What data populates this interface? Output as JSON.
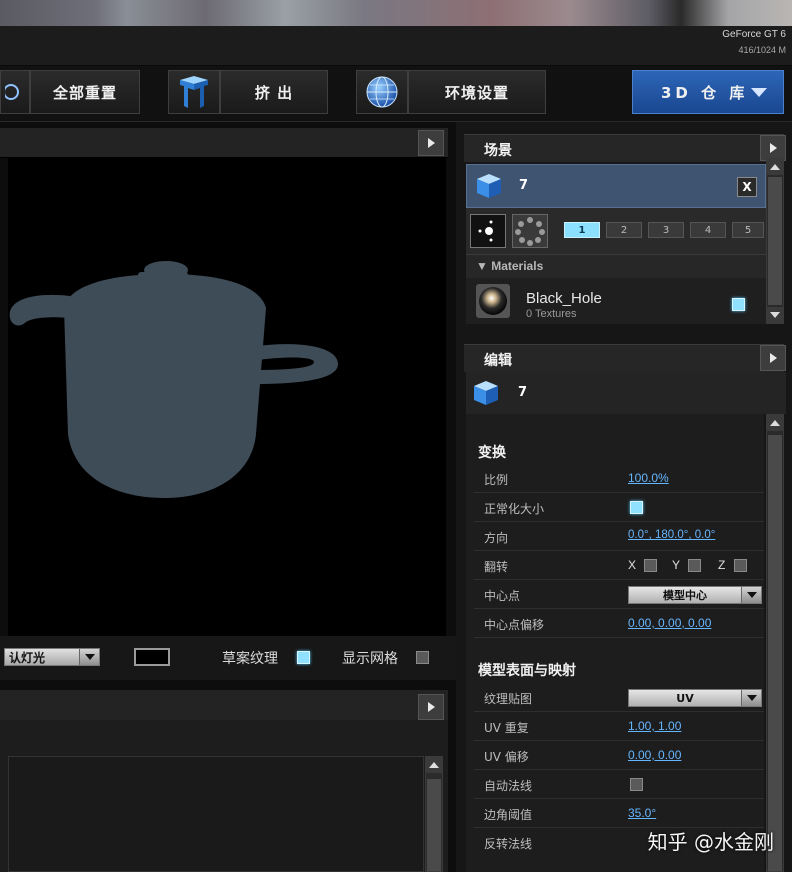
{
  "window": {
    "gpu_name": "GeForce GT 6",
    "gpu_memory": "416/1024 M"
  },
  "toolbar": {
    "reset_all_label": "全部重置",
    "extrude_label": "挤 出",
    "environment_label": "环境设置",
    "repository_label": "3D 仓 库"
  },
  "viewport": {
    "light_select_value": "认灯光",
    "draft_texture_label": "草案纹理",
    "draft_texture_checked": true,
    "show_grid_label": "显示网格",
    "show_grid_checked": false
  },
  "scene_panel": {
    "title": "场景",
    "object_name": "7",
    "close_label": "X",
    "layers": [
      "1",
      "2",
      "3",
      "4",
      "5"
    ],
    "active_layer": "1",
    "materials_header": "▼ Materials",
    "material": {
      "name": "Black_Hole",
      "textures": "0 Textures",
      "checked": true
    }
  },
  "edit_panel": {
    "title": "编辑",
    "object_name": "7",
    "transform_section": "变换",
    "transform_rows": {
      "scale": {
        "label": "比例",
        "value": "100.0%"
      },
      "normalize_size": {
        "label": "正常化大小",
        "checked": true
      },
      "orientation": {
        "label": "方向",
        "value": "0.0°, 180.0°, 0.0°"
      },
      "flip": {
        "label": "翻转",
        "x": "X",
        "y": "Y",
        "z": "Z"
      },
      "pivot": {
        "label": "中心点",
        "value": "模型中心"
      },
      "pivot_offset": {
        "label": "中心点偏移",
        "value": "0.00, 0.00, 0.00"
      }
    },
    "mapping_section": "模型表面与映射",
    "mapping_rows": {
      "texture_map": {
        "label": "纹理贴图",
        "value": "UV"
      },
      "uv_repeat": {
        "label": "UV 重复",
        "value": "1.00, 1.00"
      },
      "uv_offset": {
        "label": "UV 偏移",
        "value": "0.00, 0.00"
      },
      "auto_normals": {
        "label": "自动法线",
        "checked": false
      },
      "edge_threshold": {
        "label": "边角阈值",
        "value": "35.0°"
      },
      "flip_normals": {
        "label": "反转法线"
      }
    }
  },
  "watermark": "知乎 @水金刚",
  "colors": {
    "accent_blue": "#2d66b8",
    "checkbox_on": "#8fe1ff",
    "link_value": "#66b6ff",
    "pot_fill": "#3e4c58"
  },
  "icons": [
    "cube-icon",
    "extrude-icon",
    "globe-icon",
    "chevron-down-icon",
    "play-icon",
    "point-light-icon",
    "spot-light-icon",
    "material-sphere-icon"
  ]
}
